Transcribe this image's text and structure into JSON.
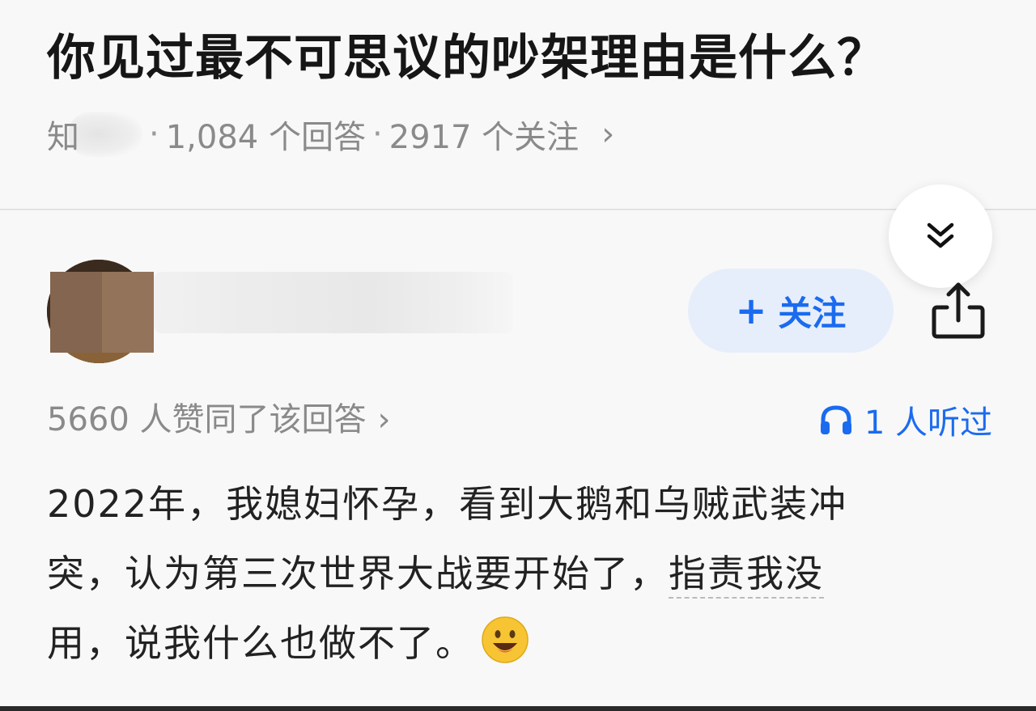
{
  "question": {
    "title": "你见过最不可思议的吵架理由是什么？",
    "source_char": "知",
    "answers": "1,084 个回答",
    "followers": "2917 个关注",
    "separator": "·",
    "chevron": "›"
  },
  "author": {
    "follow_plus": "+",
    "follow_label": "关注"
  },
  "stats": {
    "votes": "5660 人赞同了该回答",
    "votes_chevron": "›",
    "listens": "1 人听过"
  },
  "answer": {
    "line1": "2022年，我媳妇怀孕，看到大鹅和乌贼武装冲",
    "line2_a": "突，认为第三次世界大战要开始了，",
    "line2_b": "指责我没",
    "line3": "用，说我什么也做不了。"
  },
  "colors": {
    "accent": "#1a6bf0",
    "follow_bg": "#e7eefb",
    "meta_gray": "#8a8a8a",
    "background": "#f8f8f8"
  },
  "icons": {
    "collapse": "double-chevron-down-icon",
    "share": "share-icon",
    "listen": "headphones-icon",
    "emoji": "grinning-face-icon"
  }
}
